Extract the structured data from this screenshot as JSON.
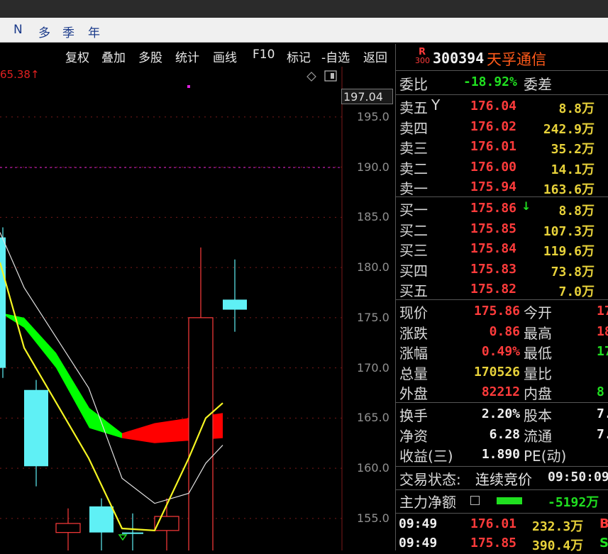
{
  "period_bar": {
    "items": [
      "N",
      "多",
      "季",
      "年"
    ]
  },
  "toolbar": {
    "items": [
      "复权",
      "叠加",
      "多股",
      "统计",
      "画线",
      "F10",
      "标记",
      "-自选",
      "返回"
    ]
  },
  "chart": {
    "ref_label": "65.38↑",
    "current_price_box": "197.04",
    "y_ticks": [
      "195.0",
      "190.0",
      "185.0",
      "180.0",
      "175.0",
      "170.0",
      "165.0",
      "160.0",
      "155.0"
    ],
    "colors": {
      "up": "#ff3b3b",
      "down": "#5ff0f5",
      "ma_yellow": "#f5f522",
      "ma_white": "#e0e0e0",
      "cloud_up": "#00ff00",
      "cloud_down": "#ff0000"
    }
  },
  "chart_data": {
    "type": "candlestick",
    "ylim": [
      150.2,
      199.0
    ],
    "y_ticks": [
      195,
      190,
      185,
      180,
      175,
      170,
      165,
      160,
      155
    ],
    "candles": [
      {
        "open": 183.0,
        "close": 170.0,
        "high": 184.0,
        "low": 169.0,
        "dir": "down"
      },
      {
        "open": 167.8,
        "close": 160.2,
        "high": 168.8,
        "low": 158.2,
        "dir": "down"
      },
      {
        "open": 154.5,
        "close": 153.6,
        "high": 156.0,
        "low": 150.2,
        "dir": "up"
      },
      {
        "open": 156.2,
        "close": 153.6,
        "high": 157.0,
        "low": 150.2,
        "dir": "down"
      },
      {
        "open": 153.5,
        "close": 153.6,
        "high": 155.5,
        "low": 150.2,
        "dir": "down"
      },
      {
        "open": 153.8,
        "close": 155.2,
        "high": 157.0,
        "low": 150.2,
        "dir": "up"
      },
      {
        "open": 150.2,
        "close": 175.0,
        "high": 182.0,
        "low": 150.2,
        "dir": "up"
      },
      {
        "open": 176.8,
        "close": 175.8,
        "high": 180.8,
        "low": 173.6,
        "dir": "down"
      }
    ],
    "ma_yellow": [
      180.5,
      172.0,
      161.0,
      154.0,
      153.8,
      161.0,
      165.0,
      166.5
    ],
    "ma_white": [
      183.5,
      178.0,
      168.0,
      159.0,
      156.5,
      157.5,
      160.5,
      162.3
    ],
    "cloud": [
      {
        "a": 175.5,
        "b": 175.5
      },
      {
        "a": 175.0,
        "b": 174.0
      },
      {
        "a": 171.5,
        "b": 170.0
      },
      {
        "a": 166.0,
        "b": 164.0
      },
      {
        "a": 163.5,
        "b": 163.0
      },
      {
        "a": 164.5,
        "b": 162.5
      },
      {
        "a": 165.5,
        "b": 163.0
      }
    ]
  },
  "panel": {
    "badge_top": "R",
    "badge_bottom": "300",
    "code": "300394",
    "name": "天孚通信",
    "webi_label": "委比",
    "webi_value": "-18.92%",
    "wecha_label": "委差",
    "sells": [
      {
        "label": "卖五",
        "flag": "Y",
        "price": "176.04",
        "vol": "8.8万"
      },
      {
        "label": "卖四",
        "flag": "",
        "price": "176.02",
        "vol": "242.9万"
      },
      {
        "label": "卖三",
        "flag": "",
        "price": "176.01",
        "vol": "35.2万"
      },
      {
        "label": "卖二",
        "flag": "",
        "price": "176.00",
        "vol": "14.1万"
      },
      {
        "label": "卖一",
        "flag": "",
        "price": "175.94",
        "vol": "163.6万"
      }
    ],
    "buys": [
      {
        "label": "买一",
        "price": "175.86",
        "vol": "8.8万"
      },
      {
        "label": "买二",
        "price": "175.85",
        "vol": "107.3万"
      },
      {
        "label": "买三",
        "price": "175.84",
        "vol": "119.6万"
      },
      {
        "label": "买四",
        "price": "175.83",
        "vol": "73.8万"
      },
      {
        "label": "买五",
        "price": "175.82",
        "vol": "7.0万"
      }
    ],
    "stats": [
      {
        "l1": "现价",
        "v1": "175.86",
        "c1": "#ff3b3b",
        "l2": "今开",
        "v2": "17",
        "c2": "#ff3b3b"
      },
      {
        "l1": "涨跌",
        "v1": "0.86",
        "c1": "#ff3b3b",
        "l2": "最高",
        "v2": "18",
        "c2": "#ff3b3b"
      },
      {
        "l1": "涨幅",
        "v1": "0.49%",
        "c1": "#ff3b3b",
        "l2": "最低",
        "v2": "17",
        "c2": "#20e020"
      },
      {
        "l1": "总量",
        "v1": "170526",
        "c1": "#e8d23a",
        "l2": "量比",
        "v2": "",
        "c2": "#d8d8d8"
      },
      {
        "l1": "外盘",
        "v1": "82212",
        "c1": "#ff3b3b",
        "l2": "内盘",
        "v2": "8",
        "c2": "#20e020"
      }
    ],
    "finance": [
      {
        "l1": "换手",
        "v1": "2.20%",
        "l2": "股本",
        "v2": "7."
      },
      {
        "l1": "净资",
        "v1": "6.28",
        "l2": "流通",
        "v2": "7."
      },
      {
        "l1": "收益(三)",
        "v1": "1.890",
        "l2": "PE(动)",
        "v2": ""
      }
    ],
    "trade_state_label": "交易状态:",
    "trade_state_value": "连续竞价",
    "trade_state_time": "09:50:09",
    "main_flow_label": "主力净额",
    "main_flow_value": "-5192万",
    "ticks": [
      {
        "time": "09:49",
        "price": "176.01",
        "vol": "232.3万",
        "bs": "B",
        "bs_color": "#ff3b3b"
      },
      {
        "time": "09:49",
        "price": "175.85",
        "vol": "390.4万",
        "bs": "S",
        "bs_color": "#20e020"
      }
    ]
  }
}
